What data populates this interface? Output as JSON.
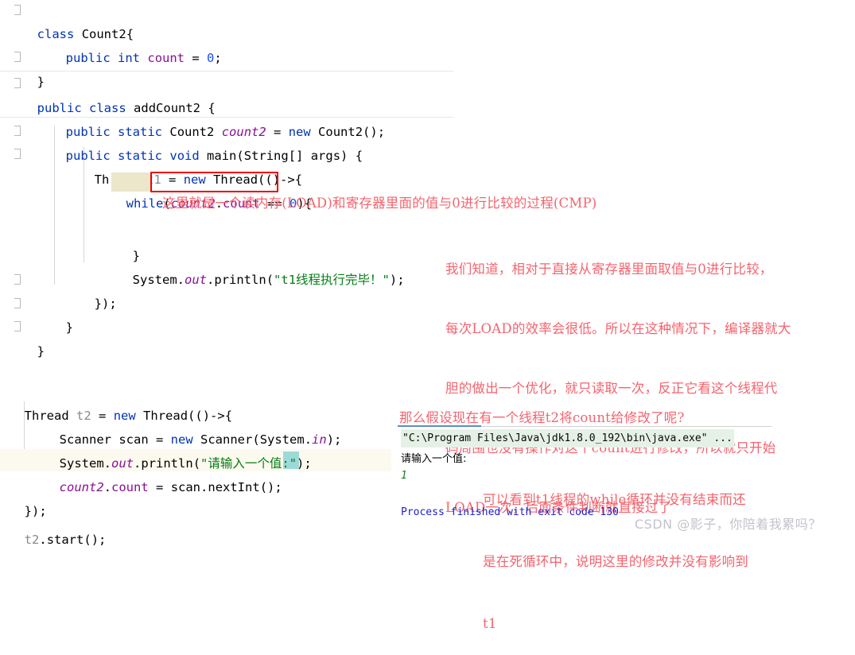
{
  "editor": {
    "top_block": {
      "lines": [
        {
          "id": "l1",
          "text": "class Count2{"
        },
        {
          "id": "l2",
          "text": "public int count = 0;"
        },
        {
          "id": "l3",
          "text": "}"
        },
        {
          "id": "l4",
          "text": "public class addCount2 {"
        },
        {
          "id": "l5",
          "text": "public static Count2 count2 = new Count2();"
        },
        {
          "id": "l6",
          "text": "public static void main(String[] args) {"
        },
        {
          "id": "l7",
          "text": "Thread t1 = new Thread(()->{"
        },
        {
          "id": "l8",
          "text": "while(count2.count == 0){"
        },
        {
          "id": "l9",
          "text": "}"
        },
        {
          "id": "l10",
          "text": "System.out.println(\"t1线程执行完毕！\");"
        },
        {
          "id": "l11",
          "text": "});"
        },
        {
          "id": "l12",
          "text": "}"
        },
        {
          "id": "l13",
          "text": "}"
        }
      ],
      "tokens": {
        "kw_class": "class",
        "kw_public": "public",
        "kw_static": "static",
        "kw_int": "int",
        "kw_void": "void",
        "kw_new": "new",
        "kw_while": "while",
        "type_count2": "Count2",
        "type_addcount2": "addCount2",
        "type_thread": "Thread",
        "type_string": "String[]",
        "ident_count": "count",
        "ident_count2": "count2",
        "ident_t1": "t1",
        "ident_args": "args",
        "ident_main": "main",
        "ident_system": "System",
        "ident_out": "out",
        "ident_println": "println",
        "literal_zero": "0",
        "string_t1_done": "\"t1线程执行完毕！\""
      }
    },
    "bottom_block": {
      "lines": [
        {
          "id": "b1",
          "text": "Thread t2 = new Thread(()->{"
        },
        {
          "id": "b2",
          "text": "Scanner scan = new Scanner(System.in);"
        },
        {
          "id": "b3",
          "text": "System.out.println(\"请输入一个值:\");"
        },
        {
          "id": "b4",
          "text": "count2.count = scan.nextInt();"
        },
        {
          "id": "b5",
          "text": "});"
        },
        {
          "id": "b6",
          "text": "t2.start();"
        }
      ],
      "tokens": {
        "type_thread": "Thread",
        "type_scanner": "Scanner",
        "ident_t2": "t2",
        "ident_scan": "scan",
        "ident_system": "System",
        "ident_in": "in",
        "ident_out": "out",
        "ident_println": "println",
        "ident_nextint": "nextInt",
        "ident_start": "start",
        "ident_count2": "count2",
        "ident_count": "count",
        "kw_new": "new",
        "string_prompt": "\"请输入一个值:\""
      }
    }
  },
  "annotations": {
    "note_load_cmp": "这里就是一个读内存(LOAD)和寄存器里面的值与0进行比较的过程(CMP)",
    "note_compiler_opt": [
      "我们知道，相对于直接从寄存器里面取值与0进行比较，",
      "每次LOAD的效率会很低。所以在这种情况下，编译器就大",
      "胆的做出一个优化，就只读取一次，反正它看这个线程代",
      "码周围也没有操作对这个count进行修改，所以就只开始",
      "LOAD一次，后面条件判断就直接过了"
    ],
    "note_thread_t2": "那么假设现在有一个线程t2将count给修改了呢?",
    "note_while_not_end": [
      "可以看到t1线程的while循环并没有结束而还",
      "是在死循环中，说明这里的修改并没有影响到",
      "t1"
    ]
  },
  "console": {
    "command_line": "\"C:\\Program Files\\Java\\jdk1.8.0_192\\bin\\java.exe\" ...",
    "prompt_output": "请输入一个值:",
    "user_input": "1",
    "exit_line": "Process finished with exit code 130"
  },
  "watermark": {
    "text": "CSDN @影子，你陪着我累吗？"
  },
  "colors": {
    "keyword": "#0033b3",
    "string": "#067d17",
    "field": "#871094",
    "number": "#1750eb",
    "annotation_red": "#f4646e",
    "redbox": "#ee0000",
    "console_highlight": "#e6f1e6",
    "line_highlight": "#fcfaef",
    "keyword_highlight": "#ece6cb",
    "teal_highlight": "#9ed9d8"
  }
}
